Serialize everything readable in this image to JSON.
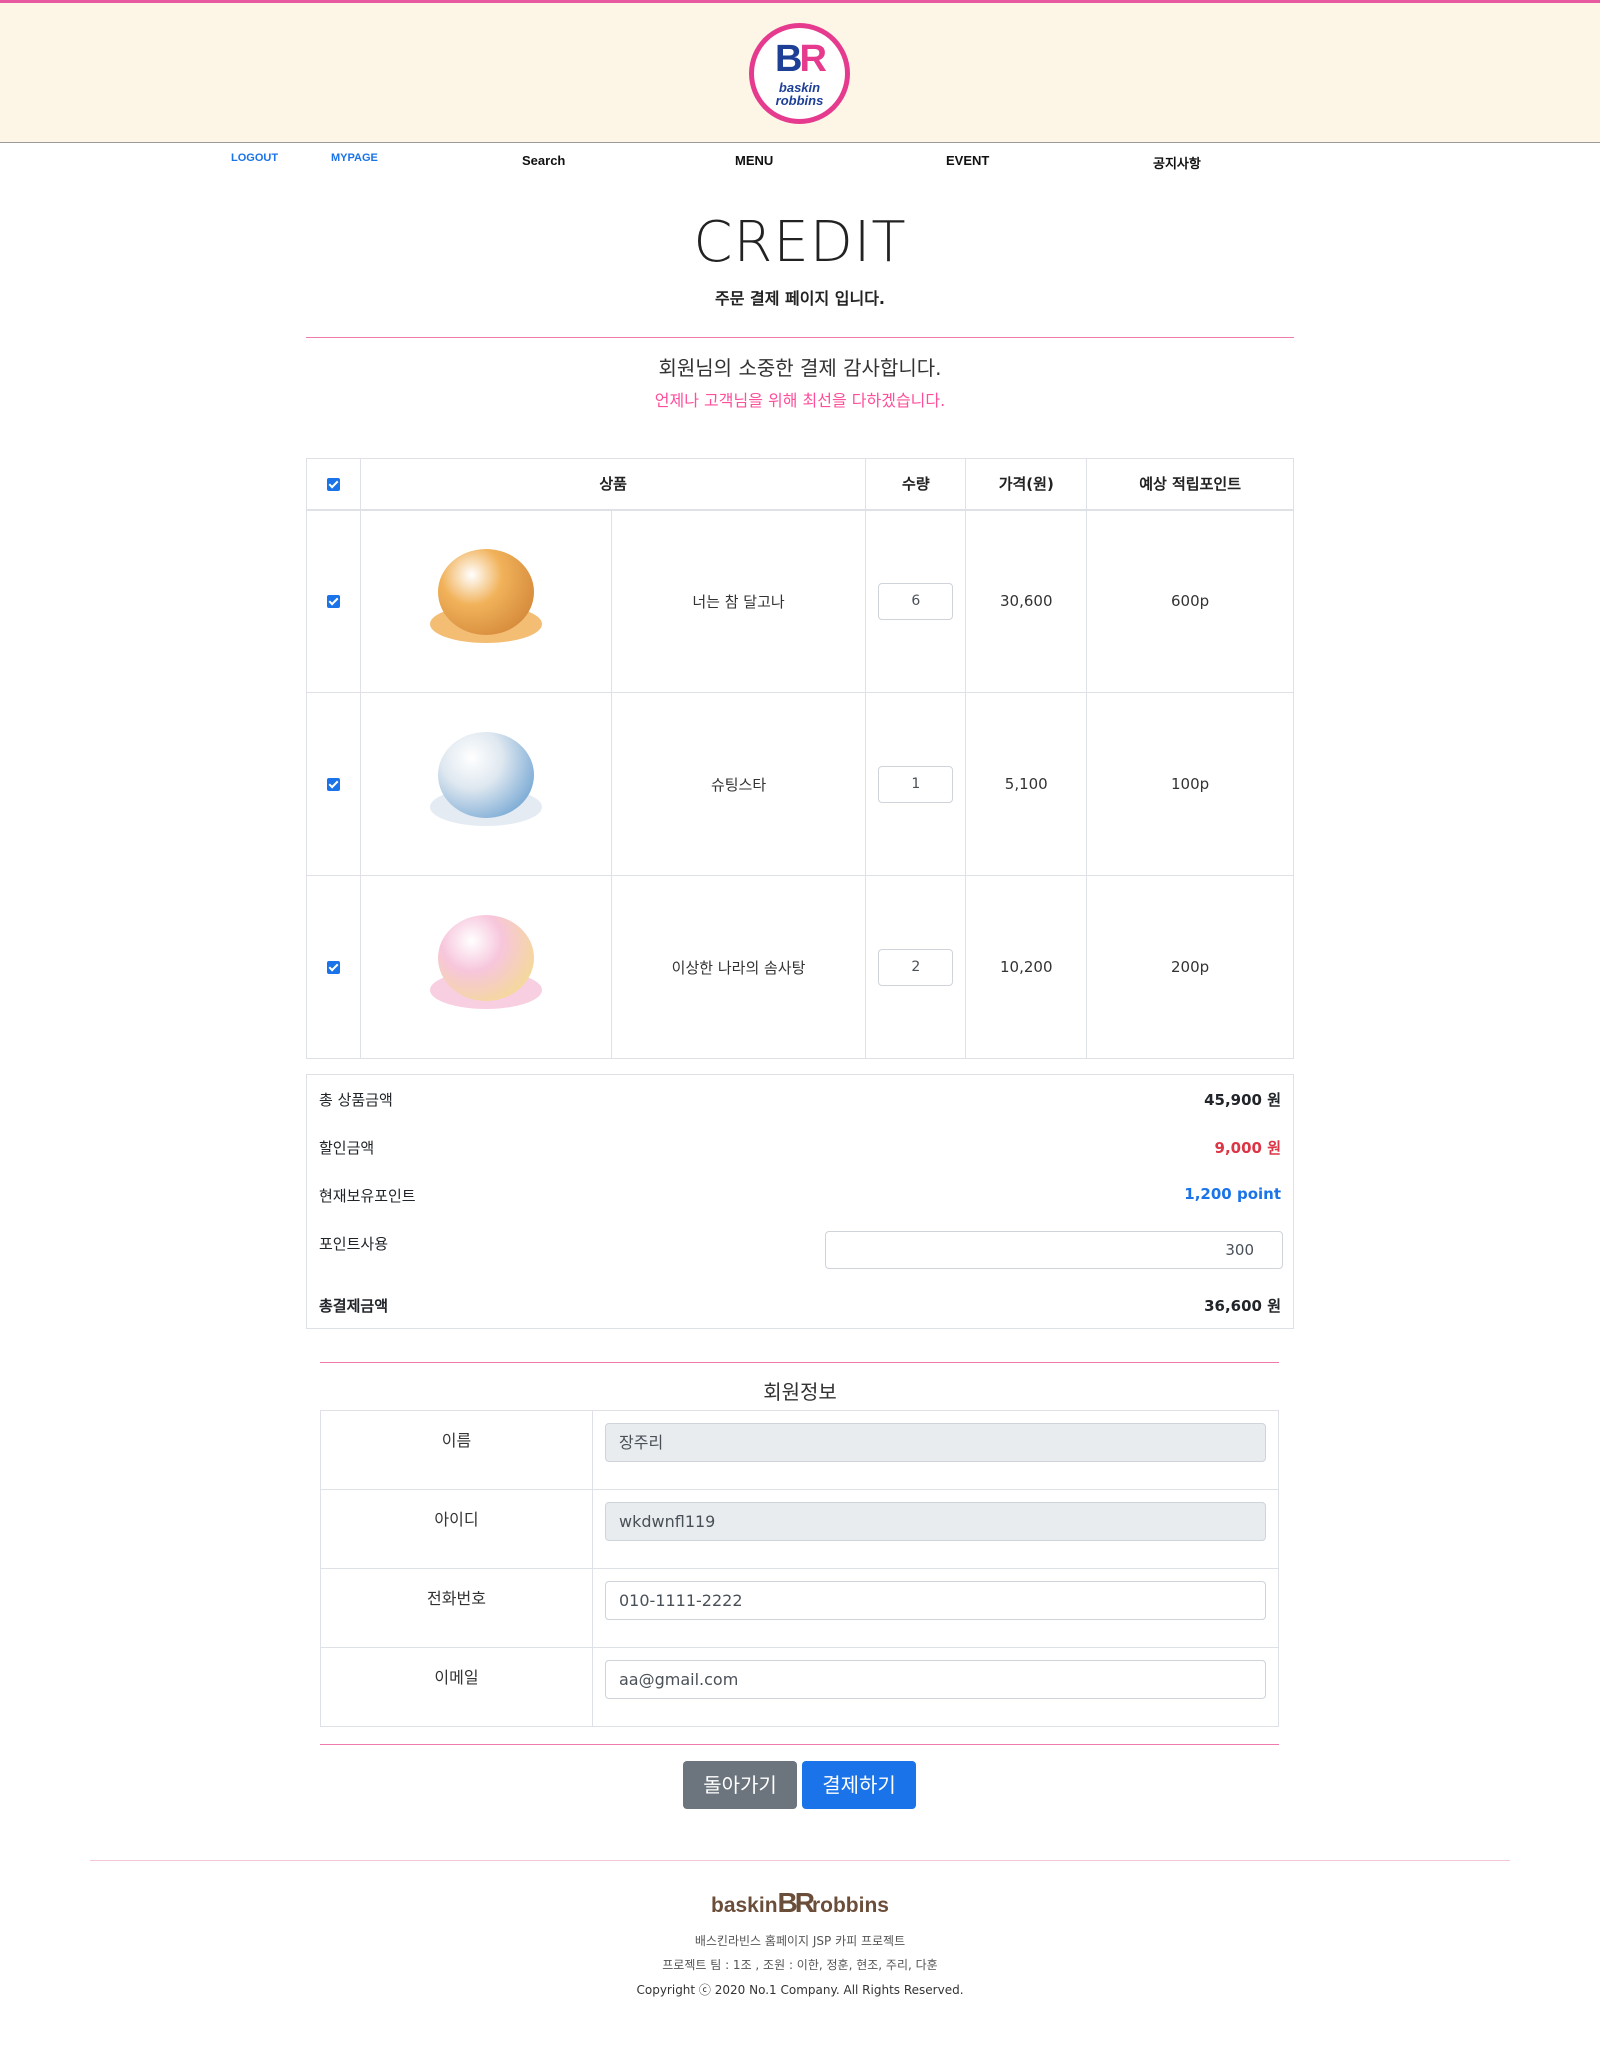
{
  "header": {
    "logo_text": "BR",
    "logo_word": "baskin robbins",
    "nav": {
      "logout": "LOGOUT",
      "mypage": "MYPAGE",
      "search": "Search",
      "menu": "MENU",
      "event": "EVENT",
      "notice": "공지사항"
    }
  },
  "page": {
    "title": "CREDIT",
    "subtitle": "주문 결제 페이지 입니다.",
    "thanks": "회원님의 소중한 결제 감사합니다.",
    "promise": "언제나 고객님을 위해 최선을 다하겠습니다."
  },
  "cart": {
    "headers": [
      "상품",
      "수량",
      "가격(원)",
      "예상 적립포인트"
    ],
    "items": [
      {
        "name": "너는 참 달고나",
        "qty": "6",
        "price": "30,600",
        "points": "600p",
        "colors": [
          "#f1b25a",
          "#c9792e"
        ]
      },
      {
        "name": "슈팅스타",
        "qty": "1",
        "price": "5,100",
        "points": "100p",
        "colors": [
          "#dfe8f0",
          "#4f8fc9"
        ]
      },
      {
        "name": "이상한 나라의 솜사탕",
        "qty": "2",
        "price": "10,200",
        "points": "200p",
        "colors": [
          "#f7c6dc",
          "#f3e27a"
        ]
      }
    ]
  },
  "summary": {
    "total_label": "총 상품금액",
    "total_value": "45,900 원",
    "discount_label": "할인금액",
    "discount_value": "9,000 원",
    "points_label": "현재보유포인트",
    "points_value": "1,200 point",
    "use_label": "포인트사용",
    "use_value": "300",
    "final_label": "총결제금액",
    "final_value": "36,600 원",
    "discount_color": "#dc3545",
    "points_color": "#1a73e8"
  },
  "member": {
    "title": "회원정보",
    "rows": [
      {
        "label": "이름",
        "value": "장주리",
        "readonly": true
      },
      {
        "label": "아이디",
        "value": "wkdwnfl119",
        "readonly": true
      },
      {
        "label": "전화번호",
        "value": "010-1111-2222",
        "readonly": false
      },
      {
        "label": "이메일",
        "value": "aa@gmail.com",
        "readonly": false
      }
    ]
  },
  "buttons": {
    "back": "돌아가기",
    "pay": "결제하기"
  },
  "footer": {
    "logo_left": "baskin",
    "logo_mid": "BR",
    "logo_right": "robbins",
    "line1": "배스킨라빈스 홈페이지 JSP 카피 프로젝트",
    "line2": "프로젝트 팀 : 1조 , 조원 : 이한, 정훈, 현조, 주리, 다훈",
    "line3": "Copyright ⓒ 2020 No.1 Company. All Rights Reserved."
  }
}
